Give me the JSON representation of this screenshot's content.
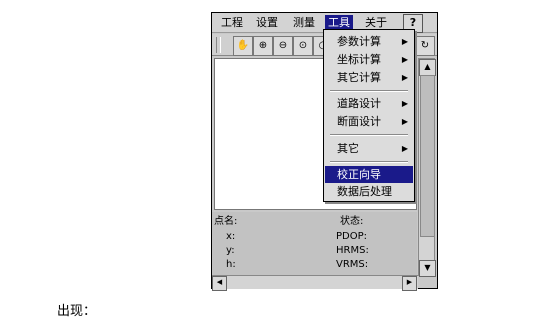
{
  "menubar": {
    "items": [
      "工程",
      "设置",
      "测量",
      "工具",
      "关于"
    ],
    "active": "工具",
    "help_icon": "?"
  },
  "toolbar": {
    "icons": [
      "pan-icon",
      "zoom-in-icon",
      "zoom-out-icon",
      "zoom-window-icon",
      "zoom-extent-icon",
      "refresh-icon"
    ]
  },
  "tools_menu": {
    "items": [
      {
        "label": "参数计算",
        "submenu": true
      },
      {
        "label": "坐标计算",
        "submenu": true
      },
      {
        "label": "其它计算",
        "submenu": true
      },
      {
        "label": "道路设计",
        "submenu": true
      },
      {
        "label": "断面设计",
        "submenu": true
      },
      {
        "label": "其它",
        "submenu": true
      },
      {
        "label": "校正向导",
        "submenu": false,
        "selected": true
      },
      {
        "label": "数据后处理",
        "submenu": false
      }
    ]
  },
  "status": {
    "point_name": "点名:",
    "x": "x:",
    "y": "y:",
    "h": "h:",
    "state": "状态:",
    "pdop": "PDOP:",
    "hrms": "HRMS:",
    "vrms": "VRMS:"
  },
  "caption": "出现：",
  "colors": {
    "selection": "#1a1a8a",
    "window_bg": "#c9c9c9"
  }
}
